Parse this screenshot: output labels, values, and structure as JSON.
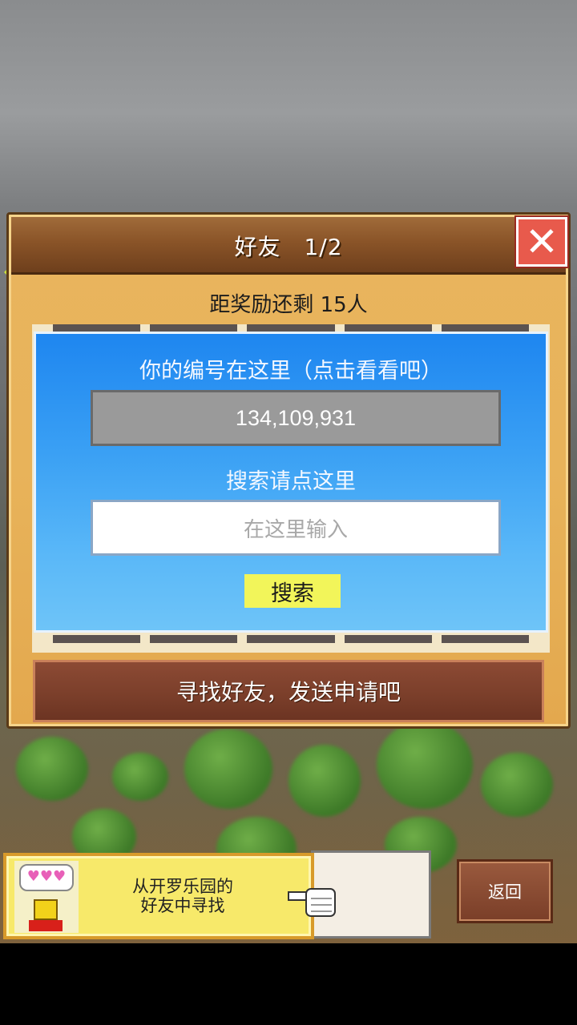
{
  "dialog": {
    "title": "好友　1/2",
    "reward_text": "距奖励还剩 15人",
    "close_icon": "close-x-icon"
  },
  "panel": {
    "id_label": "你的编号在这里（点击看看吧）",
    "id_value": "134,109,931",
    "search_label": "搜索请点这里",
    "search_placeholder": "在这里输入",
    "search_button": "搜索"
  },
  "find_button": "寻找好友，发送申请吧",
  "banner": {
    "hearts": "♥♥♥",
    "line1": "从开罗乐园的",
    "line2": "好友中寻找"
  },
  "return_button": "返回",
  "colors": {
    "panel_blue": "#3aa0f4",
    "search_button_yellow": "#f2f55a",
    "close_red": "#e85a4c"
  }
}
